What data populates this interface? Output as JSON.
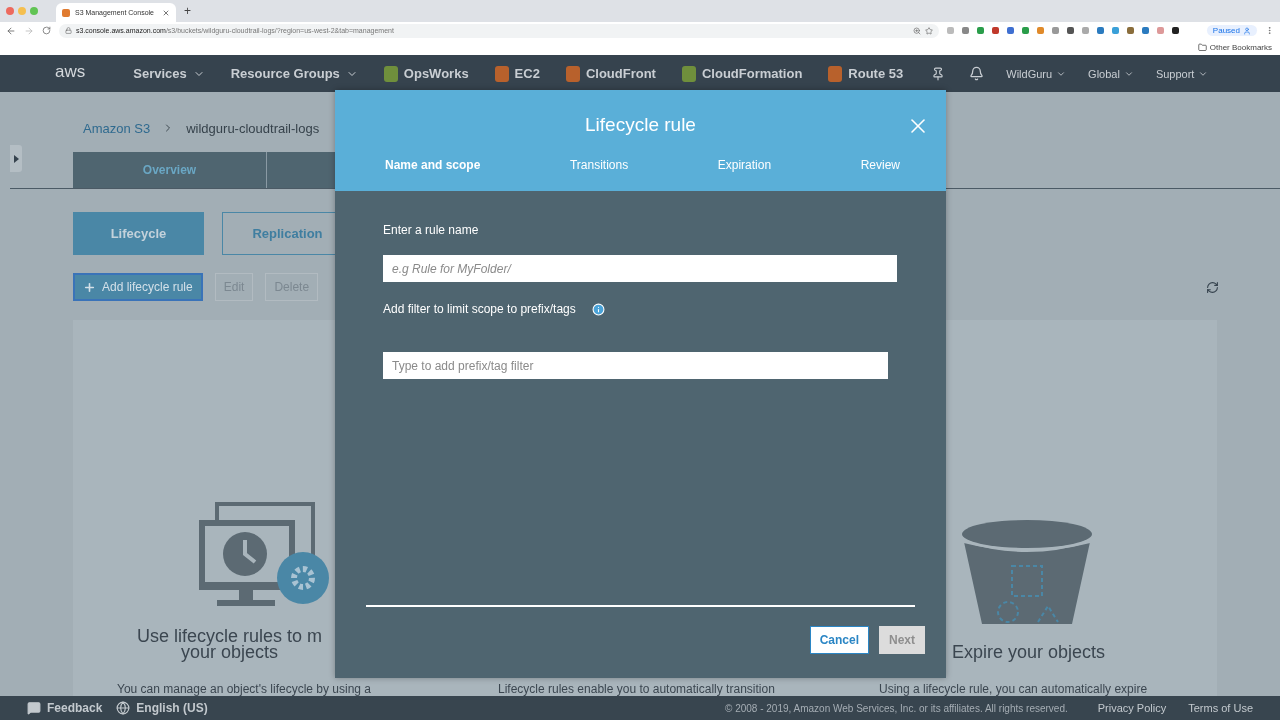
{
  "browser": {
    "tab_title": "S3 Management Console",
    "new_tab": "+",
    "url_host": "s3.console.aws.amazon.com",
    "url_path": "/s3/buckets/wildguru-cloudtrail-logs/?region=us-west-2&tab=management",
    "profile": "Paused",
    "bookmarks": "Other Bookmarks"
  },
  "nav": {
    "logo": "aws",
    "items": [
      {
        "label": "Services",
        "kind": "menu"
      },
      {
        "label": "Resource Groups",
        "kind": "menu"
      },
      {
        "label": "OpsWorks",
        "kind": "service",
        "color": "#6f8f3c"
      },
      {
        "label": "EC2",
        "kind": "service",
        "color": "#b8612c"
      },
      {
        "label": "CloudFront",
        "kind": "service",
        "color": "#b8612c"
      },
      {
        "label": "CloudFormation",
        "kind": "service",
        "color": "#6f8f3c"
      },
      {
        "label": "Route 53",
        "kind": "service",
        "color": "#b8612c"
      }
    ],
    "right": [
      {
        "label": "WildGuru"
      },
      {
        "label": "Global"
      },
      {
        "label": "Support"
      }
    ]
  },
  "breadcrumb": [
    "Amazon S3",
    "wildguru-cloudtrail-logs"
  ],
  "tabs": [
    {
      "label": "Overview",
      "selected": false
    }
  ],
  "subtabs": [
    {
      "label": "Lifecycle",
      "selected": true
    },
    {
      "label": "Replication",
      "selected": false
    }
  ],
  "actions": [
    {
      "label": "Add lifecycle rule",
      "kind": "primary",
      "disabled": false
    },
    {
      "label": "Edit",
      "kind": "plain",
      "disabled": true
    },
    {
      "label": "Delete",
      "kind": "plain",
      "disabled": true
    }
  ],
  "features": [
    {
      "kind": "schedule",
      "heading": [
        "Use lifecycle rules to m",
        "your objects"
      ],
      "text": "You can manage an object's lifecycle by using a"
    },
    {
      "kind": "transition",
      "text": "Lifecycle rules enable you to automatically transition"
    },
    {
      "kind": "bucket",
      "heading": [
        "Expire your objects"
      ],
      "text": "Using a lifecycle rule, you can automatically expire"
    }
  ],
  "modal": {
    "title": "Lifecycle rule",
    "steps": [
      {
        "label": "Name and scope",
        "selected": true
      },
      {
        "label": "Transitions",
        "selected": false
      },
      {
        "label": "Expiration",
        "selected": false
      },
      {
        "label": "Review",
        "selected": false
      }
    ],
    "name_label": "Enter a rule name",
    "name_field": {
      "placeholder": "e.g Rule for MyFolder/"
    },
    "filter_label": "Add filter to limit scope to prefix/tags",
    "filter_field": {
      "placeholder": "Type to add prefix/tag filter"
    },
    "buttons": [
      {
        "label": "Cancel",
        "kind": "secondary",
        "disabled": false
      },
      {
        "label": "Next",
        "kind": "primary",
        "disabled": true
      }
    ]
  },
  "footer": {
    "feedback": "Feedback",
    "language": "English (US)",
    "copyright": "© 2008 - 2019, Amazon Web Services, Inc. or its affiliates. All rights reserved.",
    "links": [
      "Privacy Policy",
      "Terms of Use"
    ]
  }
}
